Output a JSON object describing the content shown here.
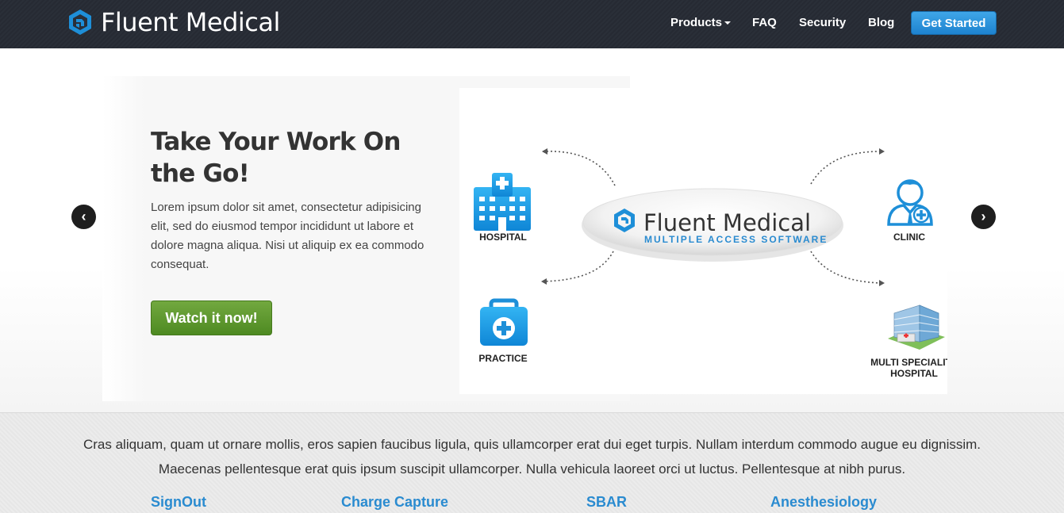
{
  "navbar": {
    "brand": "Fluent Medical",
    "items": [
      {
        "label": "Products"
      },
      {
        "label": "FAQ"
      },
      {
        "label": "Security"
      },
      {
        "label": "Blog"
      }
    ],
    "cta_label": "Get Started",
    "colors": {
      "background": "#2a2f38",
      "cta": "#2b93dc"
    }
  },
  "hero": {
    "title": "Take Your Work On the Go!",
    "body": "Lorem ipsum dolor sit amet, consectetur adipisicing elit, sed do eiusmod tempor incididunt ut labore et dolore magna aliqua. Nisi ut aliquip ex ea commodo consequat.",
    "button_label": "Watch it now!",
    "prev_label": "‹",
    "next_label": "›",
    "diagram": {
      "center_title": "Fluent Medical",
      "center_subtitle": "MULTIPLE ACCESS SOFTWARE",
      "nodes": {
        "hospital": "HOSPITAL",
        "practice": "PRACTICE",
        "clinic": "CLINIC",
        "multi_line1": "MULTI SPECIALITY",
        "multi_line2": "HOSPITAL"
      }
    }
  },
  "band": {
    "text": "Cras aliquam, quam ut ornare mollis, eros sapien faucibus ligula, quis ullamcorper erat dui eget turpis. Nullam interdum commodo augue eu dignissim. Maecenas pellentesque erat quis ipsum suscipit ullamcorper. Nulla vehicula laoreet orci ut luctus. Pellentesque at nibh purus.",
    "features": [
      {
        "label": "SignOut"
      },
      {
        "label": "Charge Capture"
      },
      {
        "label": "SBAR"
      },
      {
        "label": "Anesthesiology"
      }
    ],
    "link_color": "#2a8bd0"
  }
}
